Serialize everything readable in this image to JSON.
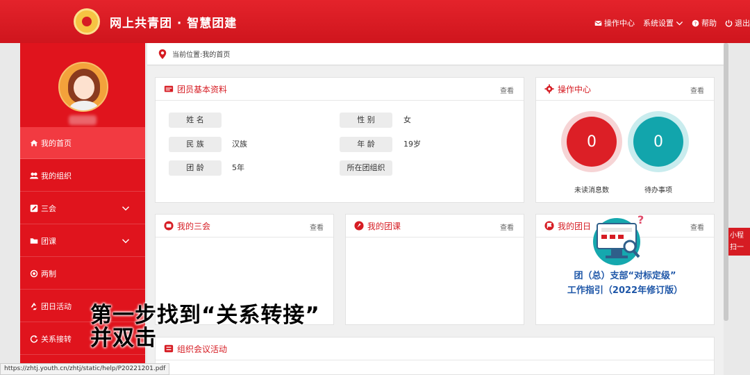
{
  "header": {
    "title": "网上共青团 · 智慧团建",
    "nav": [
      {
        "label": "操作中心",
        "icon": "envelope-icon"
      },
      {
        "label": "系统设置",
        "icon": "chevron-down-icon"
      },
      {
        "label": "帮助",
        "icon": "help-icon"
      },
      {
        "label": "退出",
        "icon": "power-icon"
      }
    ]
  },
  "sidebar": {
    "items": [
      {
        "label": "我的首页",
        "icon": "home-icon",
        "active": true
      },
      {
        "label": "我的组织",
        "icon": "users-icon"
      },
      {
        "label": "三会",
        "icon": "edit-icon",
        "expandable": true
      },
      {
        "label": "团课",
        "icon": "folder-icon",
        "expandable": true
      },
      {
        "label": "两制",
        "icon": "circle-dot-icon"
      },
      {
        "label": "团日活动",
        "icon": "recycle-icon"
      },
      {
        "label": "关系接转",
        "icon": "refresh-icon"
      }
    ]
  },
  "breadcrumb": "当前位置:我的首页",
  "profile_panel": {
    "title": "团员基本资料",
    "more": "查看",
    "fields": [
      {
        "label": "姓 名",
        "value": ""
      },
      {
        "label": "性 别",
        "value": "女"
      },
      {
        "label": "民 族",
        "value": "汉族"
      },
      {
        "label": "年 龄",
        "value": "19岁"
      },
      {
        "label": "团 龄",
        "value": "5年"
      },
      {
        "label": "所在团组织",
        "value": ""
      }
    ]
  },
  "ops_panel": {
    "title": "操作中心",
    "more": "查看",
    "unread_count": "0",
    "unread_label": "未读消息数",
    "todo_count": "0",
    "todo_label": "待办事项"
  },
  "sanhui_panel": {
    "title": "我的三会",
    "more": "查看"
  },
  "tuanke_panel": {
    "title": "我的团课",
    "more": "查看"
  },
  "tuanri_panel": {
    "title": "我的团日",
    "more": "查看",
    "promo_line1": "团（总）支部“对标定级”",
    "promo_line2": "工作指引（2022年修订版）"
  },
  "meeting_panel": {
    "title": "组织会议活动"
  },
  "overlay": {
    "line1": "第一步找到“关系转接”",
    "line2": "并双击"
  },
  "status_url": "https://zhtj.youth.cn/zhtj/static/help/P20221201.pdf",
  "side_tab": {
    "line1": "小程",
    "line2": "扫一"
  },
  "colors": {
    "brand_red": "#d61c23",
    "teal": "#12a5ac",
    "promo_blue": "#1f57a8"
  }
}
